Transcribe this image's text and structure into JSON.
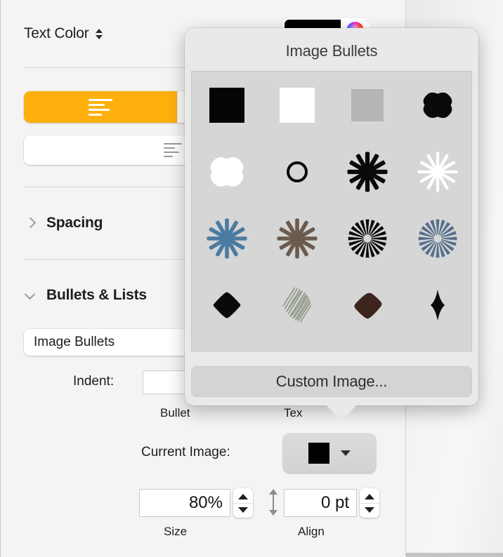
{
  "sidebar": {
    "text_color": {
      "label": "Text Color",
      "stepper_icon": "up-down-chevron-icon"
    },
    "color_well": {
      "name": "text-color-well",
      "color": "#000000",
      "wheel_icon": "color-wheel-icon"
    },
    "alignment": {
      "options": [
        {
          "id": "align-left",
          "icon": "align-left-icon",
          "selected": true
        },
        {
          "id": "align-center",
          "icon": "align-center-icon",
          "selected": false
        }
      ],
      "accent_color": "#FFB00D"
    },
    "indent_button": {
      "icon": "indent-decrease-icon"
    },
    "sections": [
      {
        "id": "spacing",
        "label": "Spacing",
        "expanded": false
      },
      {
        "id": "bullets-lists",
        "label": "Bullets & Lists",
        "expanded": true
      }
    ],
    "list_style_popup": {
      "value": "Image Bullets"
    },
    "indent": {
      "label": "Indent:",
      "bullet_label": "Bullet",
      "text_label": "Tex"
    },
    "current_image": {
      "label": "Current Image:",
      "swatch_color": "#000000"
    },
    "size": {
      "value": "80%",
      "caption": "Size"
    },
    "align": {
      "value": "0 pt",
      "caption": "Align"
    }
  },
  "popover": {
    "title": "Image Bullets",
    "custom_button": "Custom Image...",
    "bullets": [
      {
        "id": "black-square",
        "name": "black-square-bullet"
      },
      {
        "id": "white-square",
        "name": "white-square-bullet"
      },
      {
        "id": "gray-square",
        "name": "gray-square-bullet"
      },
      {
        "id": "black-blob-square",
        "name": "black-rounded-blob-bullet"
      },
      {
        "id": "white-blob-square",
        "name": "white-rounded-blob-bullet"
      },
      {
        "id": "black-circle-outline",
        "name": "black-circle-outline-bullet"
      },
      {
        "id": "black-starburst",
        "name": "black-starburst-bullet"
      },
      {
        "id": "white-starburst",
        "name": "white-starburst-bullet"
      },
      {
        "id": "blue-starburst",
        "name": "blue-starburst-bullet"
      },
      {
        "id": "brown-starburst",
        "name": "brown-starburst-bullet"
      },
      {
        "id": "black-sunburst",
        "name": "black-sunburst-bullet"
      },
      {
        "id": "blue-sunburst",
        "name": "blue-sunburst-bullet"
      },
      {
        "id": "black-diamond",
        "name": "black-diamond-bullet"
      },
      {
        "id": "sketched-diamond",
        "name": "green-sketched-diamond-bullet"
      },
      {
        "id": "brown-diamond",
        "name": "brown-diamond-bullet"
      },
      {
        "id": "black-four-point-star",
        "name": "black-four-point-star-bullet"
      }
    ],
    "colors": {
      "blue": "#4b7ba0",
      "blue_dark": "#566f8c",
      "brown": "#6b5b4e",
      "brown_dark": "#3c251c",
      "sketch_green": "#8d9683"
    }
  }
}
